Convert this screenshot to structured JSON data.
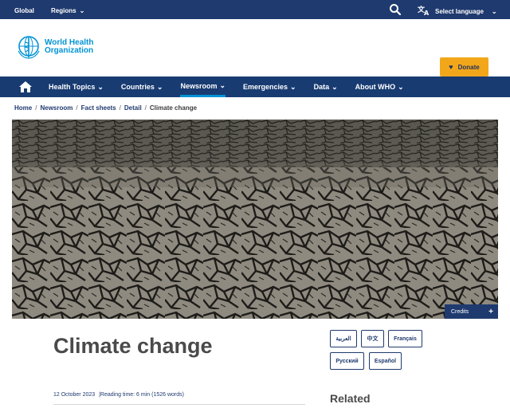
{
  "topbar": {
    "global_label": "Global",
    "regions_label": "Regions",
    "language_label": "Select language"
  },
  "logo": {
    "line1": "World Health",
    "line2": "Organization"
  },
  "donate_label": "Donate",
  "nav": {
    "items": [
      {
        "label": "Health Topics"
      },
      {
        "label": "Countries"
      },
      {
        "label": "Newsroom"
      },
      {
        "label": "Emergencies"
      },
      {
        "label": "Data"
      },
      {
        "label": "About WHO"
      }
    ],
    "active": "Newsroom"
  },
  "breadcrumb": {
    "items": [
      "Home",
      "Newsroom",
      "Fact sheets",
      "Detail"
    ],
    "current": "Climate change"
  },
  "hero": {
    "credits_label": "Credits"
  },
  "article": {
    "title": "Climate change",
    "date": "12 October 2023",
    "reading_time": "|Reading time: 6 min (1526 words)"
  },
  "languages": [
    "العربية",
    "中文",
    "Français",
    "Русский",
    "Español"
  ],
  "sidebar": {
    "related_label": "Related"
  },
  "colors": {
    "brand_dark": "#1f3a6f",
    "brand_light": "#0093d5",
    "donate": "#f2a71b"
  }
}
